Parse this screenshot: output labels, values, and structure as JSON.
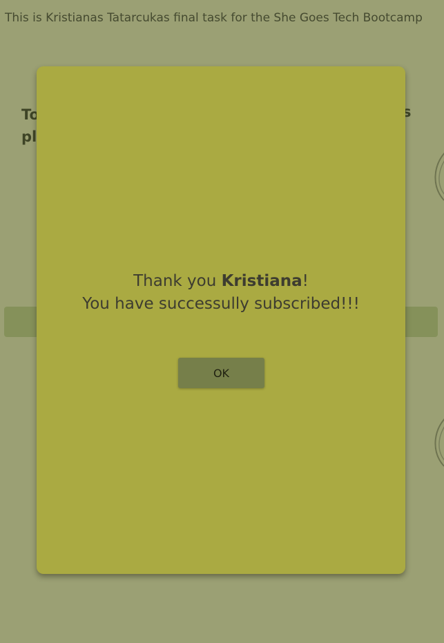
{
  "header": {
    "text": "This is Kristianas Tatarcukas final task for the She Goes Tech Bootcamp"
  },
  "background": {
    "heading_left_line1": "To",
    "heading_left_line2": "pl",
    "heading_right_fragment": "s"
  },
  "modal": {
    "thank_prefix": "Thank you ",
    "name": "Kristiana",
    "thank_suffix": "!",
    "subscribed_text": "You have successully subscribed!!!",
    "ok_label": "OK"
  },
  "colors": {
    "page_background": "#9ba074",
    "modal_background": "#aaaa42",
    "button_background": "#767f4a",
    "bar_background": "#85915a"
  }
}
